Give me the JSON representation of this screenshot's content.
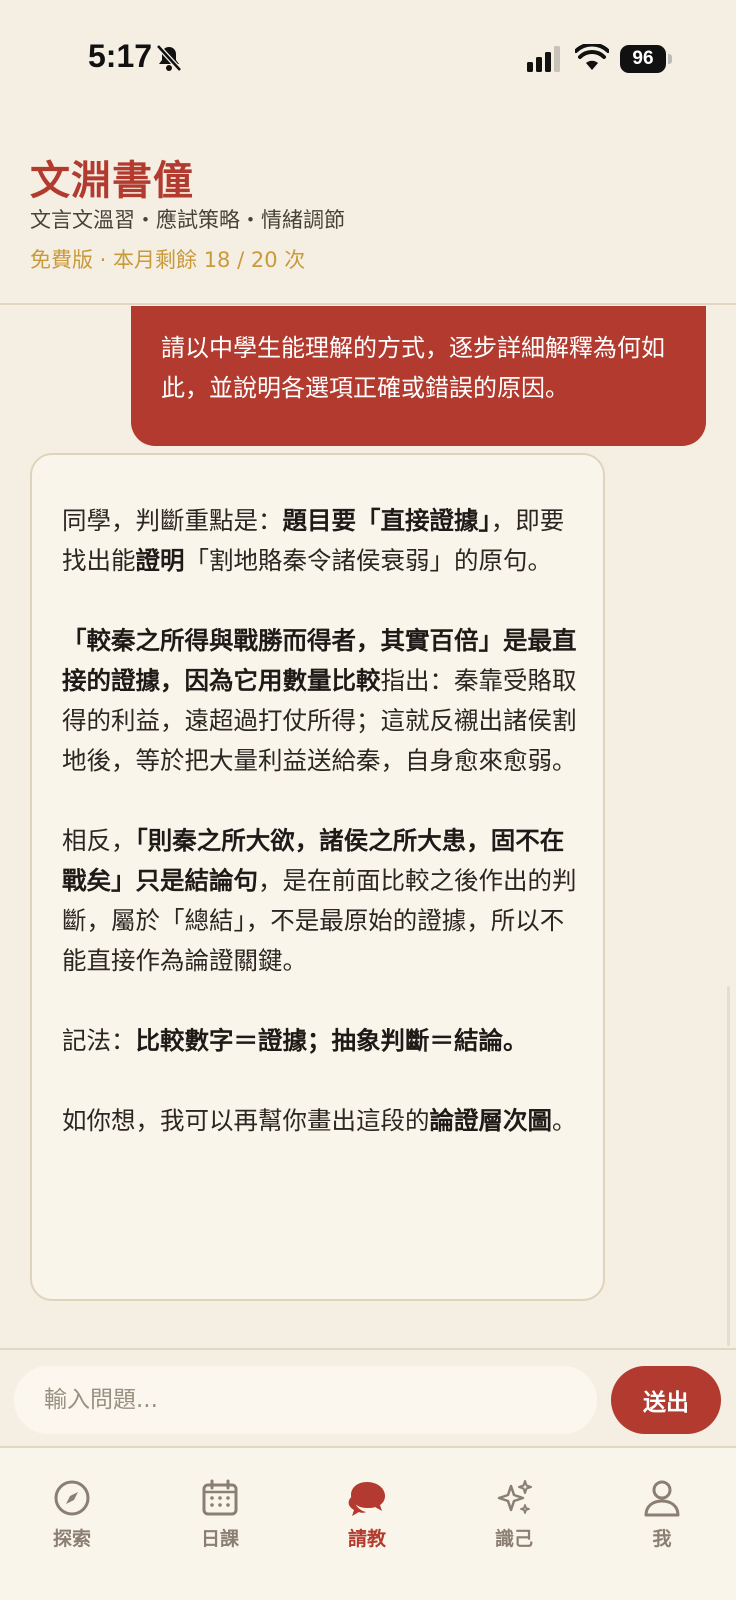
{
  "status_bar": {
    "time": "5:17",
    "battery": "96"
  },
  "header": {
    "title": "文淵書僮",
    "subtitle": "文言文溫習・應試策略・情緒調節",
    "quota": "免費版 · 本月剩餘 18 / 20 次"
  },
  "chat": {
    "user_message": "請以中學生能理解的方式，逐步詳細解釋為何如此，並說明各選項正確或錯誤的原因。",
    "bot_reply": {
      "p1_a": "同學，判斷重點是：",
      "p1_b": "題目要「直接證據」",
      "p1_c": "，即要找出能",
      "p1_d": "證明",
      "p1_e": "「割地賂秦令諸侯衰弱」的原句。",
      "p2_a": "「較秦之所得與戰勝而得者，其實百倍」是最直接的證據，因為它用數量比較",
      "p2_b": "指出：秦靠受賂取得的利益，遠超過打仗所得；這就反襯出諸侯割地後，等於把大量利益送給秦，自身愈來愈弱。",
      "p3_a": "相反，",
      "p3_b": "「則秦之所大欲，諸侯之所大患，固不在戰矣」只是結論句",
      "p3_c": "，是在前面比較之後作出的判斷，屬於「總結」，不是最原始的證據，所以不能直接作為論證關鍵。",
      "p4_a": "記法：",
      "p4_b": "比較數字＝證據；抽象判斷＝結論。",
      "p5_a": "如你想，我可以再幫你畫出這段的",
      "p5_b": "論證層次圖",
      "p5_c": "。"
    }
  },
  "input_bar": {
    "placeholder": "輸入問題...",
    "send_label": "送出"
  },
  "nav": {
    "items": [
      {
        "label": "探索",
        "icon": "compass-icon"
      },
      {
        "label": "日課",
        "icon": "calendar-icon"
      },
      {
        "label": "請教",
        "icon": "chat-bubbles-icon",
        "active": true
      },
      {
        "label": "識己",
        "icon": "sparkles-icon"
      },
      {
        "label": "我",
        "icon": "user-icon"
      }
    ]
  },
  "colors": {
    "accent": "#b23a2e",
    "background": "#f5efe3",
    "gold": "#c99a3a",
    "inactive": "#8a7f72"
  }
}
